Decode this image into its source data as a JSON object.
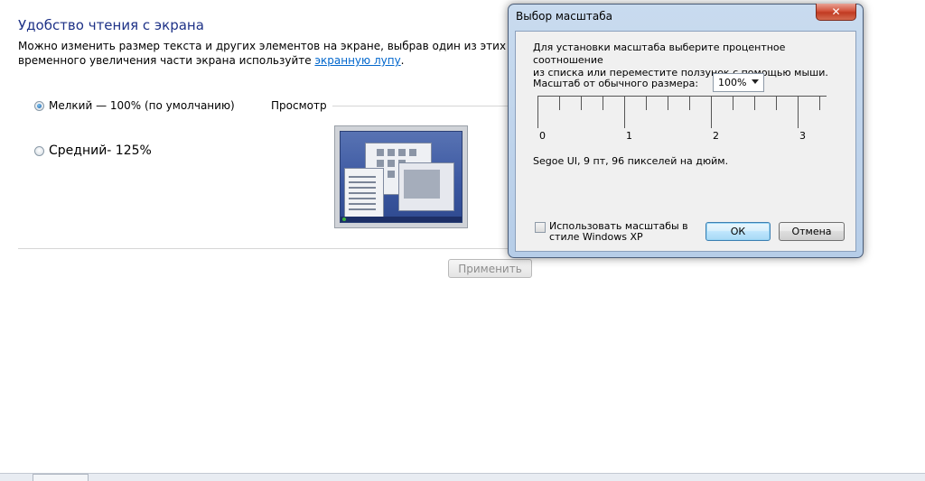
{
  "main": {
    "title": "Удобство чтения с экрана",
    "desc_line1": "Можно изменить размер текста и других элементов на экране, выбрав один из этих параметров. Д",
    "desc_line2_prefix": "временного увеличения части экрана используйте ",
    "desc_link": "экранную лупу",
    "desc_line2_suffix": ".",
    "option_small": "Мелкий — 100% (по умолчанию)",
    "option_medium": "Средний- 125%",
    "preview_label": "Просмотр",
    "apply_button": "Применить"
  },
  "dialog": {
    "title": "Выбор масштаба",
    "close_glyph": "✕",
    "info_line1": "Для установки масштаба выберите процентное соотношение",
    "info_line2": "из списка или переместите ползунок с помощью мыши.",
    "scale_label": "Масштаб от обычного размера:",
    "scale_value": "100%",
    "ruler_numbers": [
      "0",
      "1",
      "2",
      "3"
    ],
    "font_info": "Segoe UI, 9 пт, 96 пикселей на дюйм.",
    "xp_checkbox_line1": "Использовать масштабы в",
    "xp_checkbox_line2": "стиле Windows XP",
    "ok_button": "ОК",
    "cancel_button": "Отмена"
  },
  "colors": {
    "title_blue": "#1e3287",
    "link_blue": "#0066cc",
    "close_red": "#c13b22"
  }
}
